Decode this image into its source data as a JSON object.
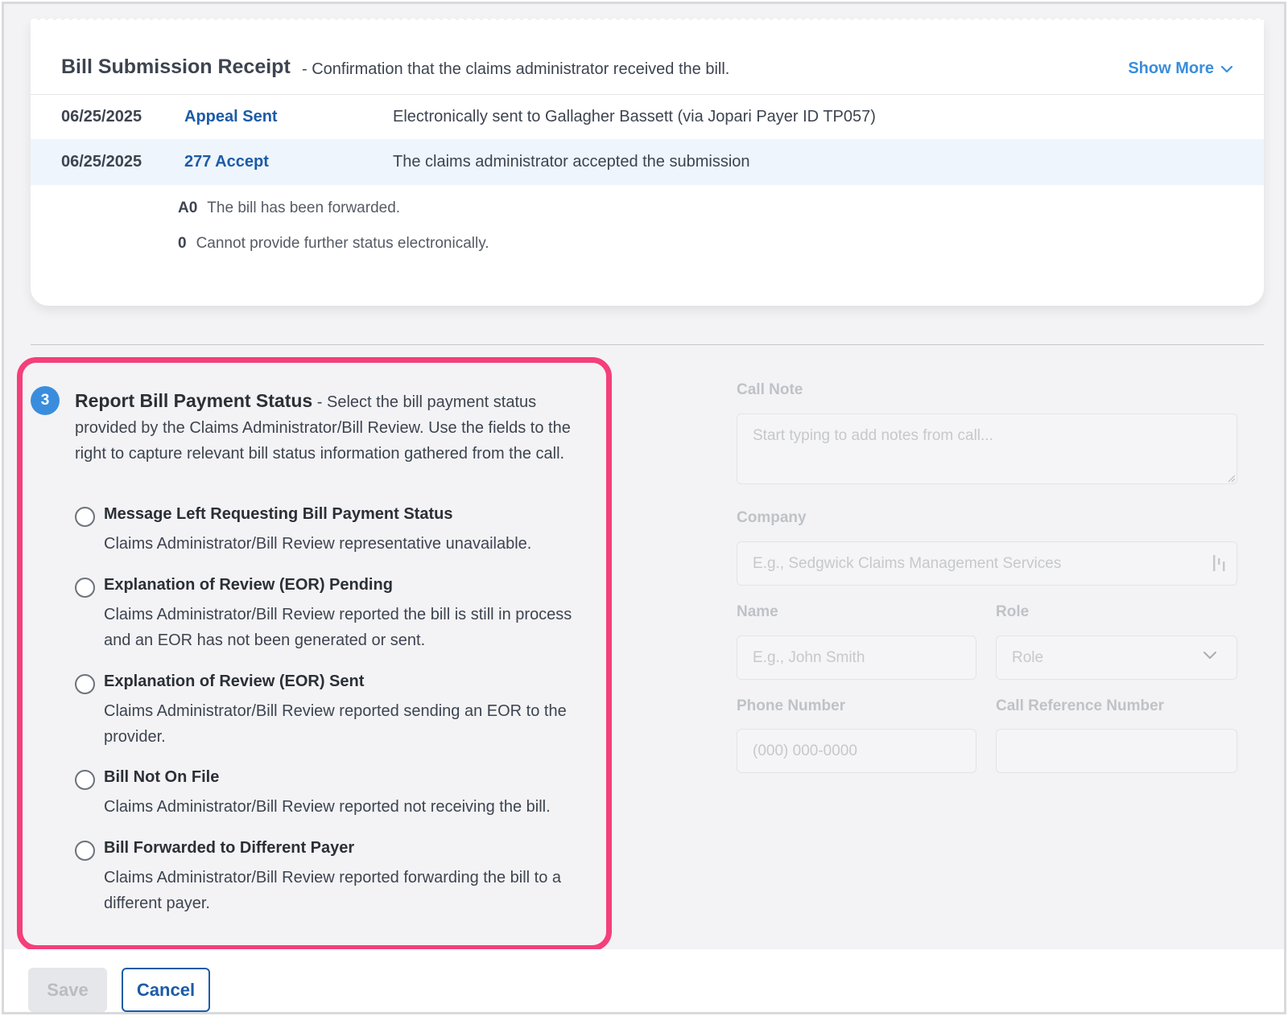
{
  "receipt": {
    "title": "Bill Submission Receipt",
    "subtitle": "- Confirmation that the claims administrator received the bill.",
    "show_more": "Show More",
    "rows": [
      {
        "date": "06/25/2025",
        "event": "Appeal Sent",
        "desc": "Electronically sent to Gallagher Bassett (via Jopari Payer ID TP057)"
      },
      {
        "date": "06/25/2025",
        "event": "277 Accept",
        "desc": "The claims administrator accepted the submission"
      }
    ],
    "codes": [
      {
        "code": "A0",
        "text": "The bill has been forwarded."
      },
      {
        "code": "0",
        "text": "Cannot provide further status electronically."
      }
    ]
  },
  "section": {
    "step": "3",
    "title": "Report Bill Payment Status",
    "description": "- Select the bill payment status provided by the Claims Administrator/Bill Review. Use the fields to the right to capture relevant bill status information gathered from the call.",
    "options": [
      {
        "title": "Message Left Requesting Bill Payment Status",
        "desc": "Claims Administrator/Bill Review representative unavailable."
      },
      {
        "title": "Explanation of Review (EOR) Pending",
        "desc": "Claims Administrator/Bill Review reported the bill is still in process and an EOR has not been generated or sent."
      },
      {
        "title": "Explanation of Review (EOR) Sent",
        "desc": "Claims Administrator/Bill Review reported sending an EOR to the provider."
      },
      {
        "title": "Bill Not On File",
        "desc": "Claims Administrator/Bill Review reported not receiving the bill."
      },
      {
        "title": "Bill Forwarded to Different Payer",
        "desc": "Claims Administrator/Bill Review reported forwarding the bill to a different payer."
      }
    ]
  },
  "form": {
    "call_note_label": "Call Note",
    "call_note_placeholder": "Start typing to add notes from call...",
    "company_label": "Company",
    "company_placeholder": "E.g., Sedgwick Claims Management Services",
    "name_label": "Name",
    "name_placeholder": "E.g., John Smith",
    "role_label": "Role",
    "role_value": "Role",
    "phone_label": "Phone Number",
    "phone_placeholder": "(000) 000-0000",
    "ref_label": "Call Reference Number",
    "ref_placeholder": ""
  },
  "footer": {
    "save_label": "Save",
    "cancel_label": "Cancel"
  },
  "colors": {
    "accent": "#1c5ba8",
    "link": "#3a8ddd",
    "highlight_border": "#f43f7a",
    "row_highlight": "#eef5fc"
  }
}
